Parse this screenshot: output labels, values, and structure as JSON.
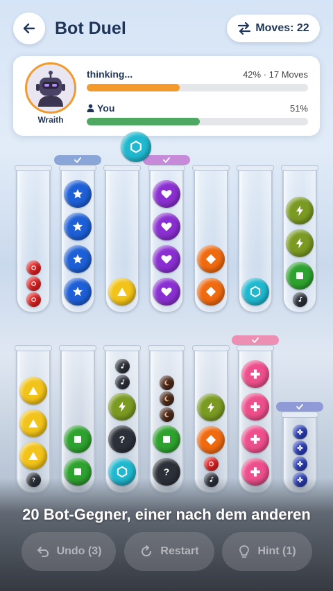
{
  "header": {
    "title": "Bot Duel",
    "moves_label": "Moves: 22"
  },
  "bot": {
    "name": "Wraith",
    "status": "thinking...",
    "stats": "42% · 17 Moves",
    "progress": 0.42,
    "bar_color": "#f39a2c"
  },
  "player": {
    "label": "You",
    "percent": "51%",
    "progress": 0.51,
    "bar_color": "#4fa862"
  },
  "held_ball": {
    "color": "teal",
    "icon": "hexagon-icon"
  },
  "tubes_top": [
    {
      "balls": [
        {
          "color": "red",
          "icon": "circle-icon",
          "small": true
        },
        {
          "color": "red",
          "icon": "circle-icon",
          "small": true
        },
        {
          "color": "red",
          "icon": "circle-icon",
          "small": true
        }
      ]
    },
    {
      "cap": "blue",
      "balls": [
        {
          "color": "blue",
          "icon": "star-icon"
        },
        {
          "color": "blue",
          "icon": "star-icon"
        },
        {
          "color": "blue",
          "icon": "star-icon"
        },
        {
          "color": "blue",
          "icon": "star-icon"
        }
      ]
    },
    {
      "balls": [
        {
          "color": "yellow",
          "icon": "triangle-icon"
        }
      ]
    },
    {
      "cap": "purple",
      "balls": [
        {
          "color": "purple",
          "icon": "heart-icon"
        },
        {
          "color": "purple",
          "icon": "heart-icon"
        },
        {
          "color": "purple",
          "icon": "heart-icon"
        },
        {
          "color": "purple",
          "icon": "heart-icon"
        }
      ]
    },
    {
      "balls": [
        {
          "color": "orange",
          "icon": "diamond-icon"
        },
        {
          "color": "orange",
          "icon": "diamond-icon"
        }
      ]
    },
    {
      "balls": [
        {
          "color": "teal",
          "icon": "hexagon-icon"
        }
      ]
    },
    {
      "balls": [
        {
          "color": "dark",
          "icon": "music-icon",
          "small": true
        },
        {
          "color": "green",
          "icon": "square-icon"
        },
        {
          "color": "olive",
          "icon": "bolt-icon"
        },
        {
          "color": "olive",
          "icon": "bolt-icon"
        }
      ]
    }
  ],
  "tubes_bottom": [
    {
      "balls": [
        {
          "color": "dark",
          "icon": "question-icon",
          "small": true
        },
        {
          "color": "yellow",
          "icon": "triangle-icon"
        },
        {
          "color": "yellow",
          "icon": "triangle-icon"
        },
        {
          "color": "yellow",
          "icon": "triangle-icon"
        }
      ]
    },
    {
      "balls": [
        {
          "color": "green",
          "icon": "square-icon"
        },
        {
          "color": "green",
          "icon": "square-icon"
        }
      ]
    },
    {
      "balls": [
        {
          "color": "teal",
          "icon": "hexagon-icon"
        },
        {
          "color": "dark",
          "icon": "question-icon"
        },
        {
          "color": "olive",
          "icon": "bolt-icon"
        },
        {
          "color": "dark",
          "icon": "music-icon",
          "small": true
        },
        {
          "color": "dark",
          "icon": "music-icon",
          "small": true
        }
      ]
    },
    {
      "balls": [
        {
          "color": "dark",
          "icon": "question-icon"
        },
        {
          "color": "green",
          "icon": "square-icon"
        },
        {
          "color": "brown",
          "icon": "moon-icon",
          "small": true
        },
        {
          "color": "brown",
          "icon": "moon-icon",
          "small": true
        },
        {
          "color": "brown",
          "icon": "moon-icon",
          "small": true
        }
      ]
    },
    {
      "balls": [
        {
          "color": "dark",
          "icon": "music-icon",
          "small": true
        },
        {
          "color": "red",
          "icon": "circle-icon",
          "small": true
        },
        {
          "color": "orange",
          "icon": "diamond-icon"
        },
        {
          "color": "olive",
          "icon": "bolt-icon"
        }
      ]
    },
    {
      "cap": "pink",
      "balls": [
        {
          "color": "pink",
          "icon": "plus-icon"
        },
        {
          "color": "pink",
          "icon": "plus-icon"
        },
        {
          "color": "pink",
          "icon": "plus-icon"
        },
        {
          "color": "pink",
          "icon": "plus-icon"
        }
      ]
    },
    {
      "cap": "navy",
      "short": true,
      "balls": [
        {
          "color": "navy",
          "icon": "flower-icon",
          "small": true
        },
        {
          "color": "navy",
          "icon": "flower-icon",
          "small": true
        },
        {
          "color": "navy",
          "icon": "flower-icon",
          "small": true
        },
        {
          "color": "navy",
          "icon": "flower-icon",
          "small": true
        }
      ]
    }
  ],
  "colors": {
    "red": "#e02222",
    "blue": "#1d5fd6",
    "yellow": "#f2c318",
    "purple": "#8a2fd1",
    "orange": "#f06a10",
    "teal": "#1fb8cf",
    "olive": "#7a9a22",
    "green": "#2ea22e",
    "dark": "#2c3038",
    "brown": "#4a2a1c",
    "pink": "#ee4f8c",
    "navy": "#2b3fb8"
  },
  "cap_colors": {
    "blue": "#8aa6d8",
    "purple": "#c68ad8",
    "pink": "#ec8fb2",
    "navy": "#8f9ad6"
  },
  "caption": "20 Bot-Gegner, einer nach dem anderen",
  "buttons": {
    "undo": "Undo (3)",
    "restart": "Restart",
    "hint": "Hint (1)"
  }
}
